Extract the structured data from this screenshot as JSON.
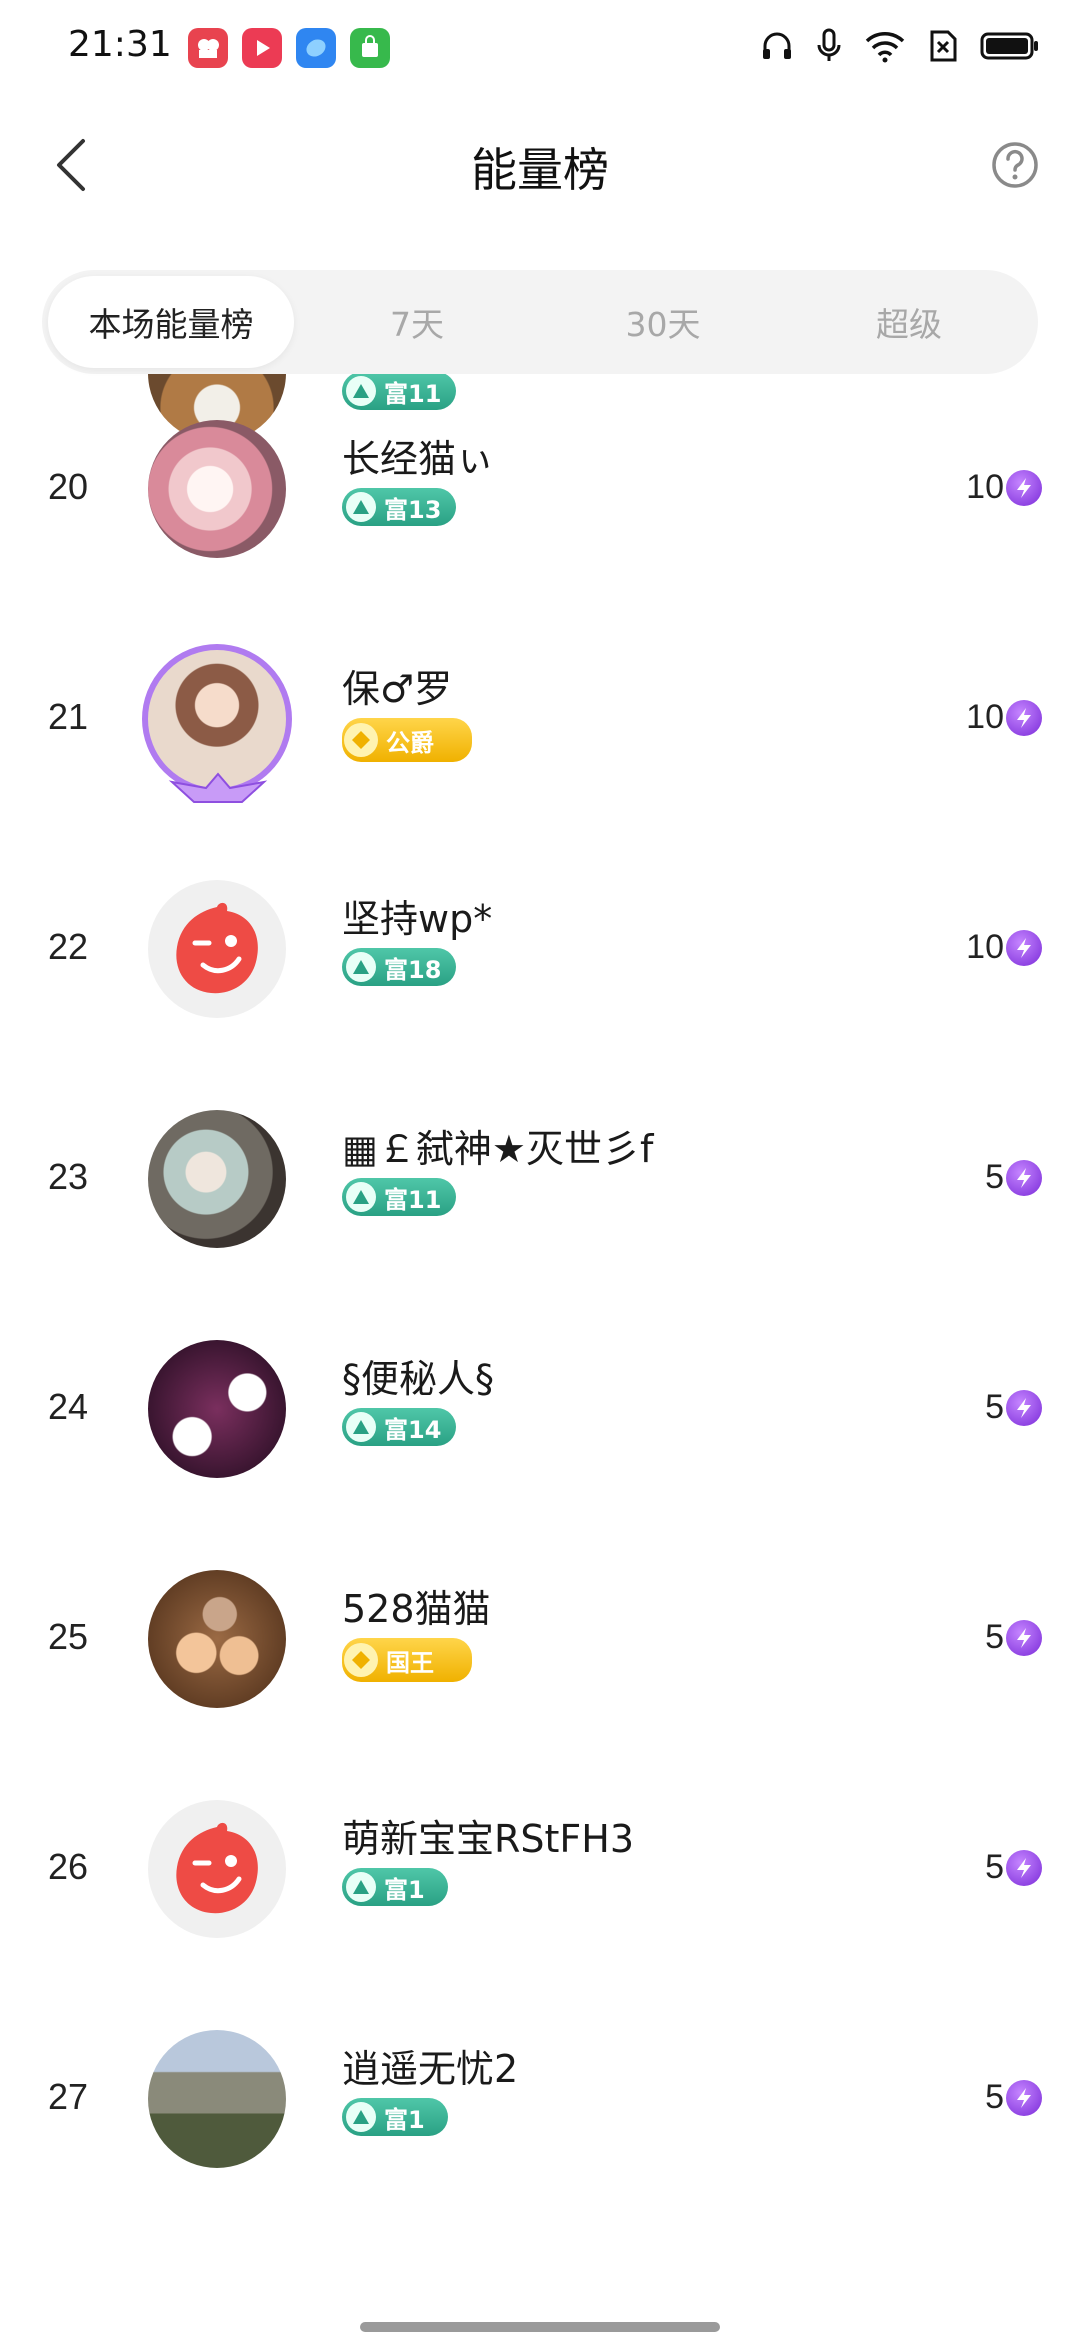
{
  "status_bar": {
    "time": "21:31"
  },
  "header": {
    "title": "能量榜"
  },
  "tabs": [
    {
      "label": "本场能量榜",
      "active": true
    },
    {
      "label": "7天",
      "active": false
    },
    {
      "label": "30天",
      "active": false
    },
    {
      "label": "超级",
      "active": false
    }
  ],
  "partial_row": {
    "badge": "富11"
  },
  "rows": [
    {
      "rank": "20",
      "name": "长经猫ぃ",
      "badge": "富13",
      "score": "10"
    },
    {
      "rank": "21",
      "name": "保♂罗",
      "badge": "公爵",
      "score": "10"
    },
    {
      "rank": "22",
      "name": "坚持wp*",
      "badge": "富18",
      "score": "10"
    },
    {
      "rank": "23",
      "name": "▦￡弑神★灭世彡f",
      "badge": "富11",
      "score": "5"
    },
    {
      "rank": "24",
      "name": "§便秘人§",
      "badge": "富14",
      "score": "5"
    },
    {
      "rank": "25",
      "name": "528猫猫",
      "badge": "国王",
      "score": "5"
    },
    {
      "rank": "26",
      "name": "萌新宝宝RStFH3",
      "badge": "富1",
      "score": "5"
    },
    {
      "rank": "27",
      "name": "逍遥无忧2",
      "badge": "富1",
      "score": "5"
    }
  ],
  "colors": {
    "badge_green": "#2aa184",
    "badge_gold": "#f0b100",
    "energy": "#7a2bd8",
    "default_avatar": "#ee4b45"
  }
}
